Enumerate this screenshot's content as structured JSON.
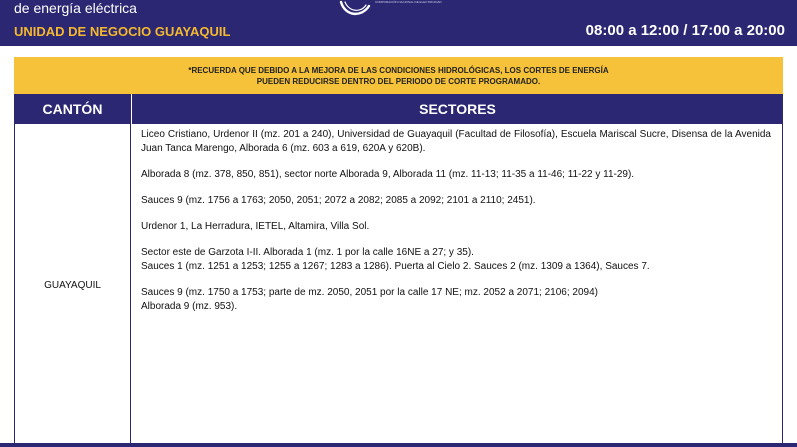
{
  "header": {
    "line1": "de energía eléctrica",
    "line2": "UNIDAD DE NEGOCIO GUAYAQUIL",
    "schedule": "08:00 a 12:00 / 17:00 a 20:00",
    "logo_tagline": "CORPORACIÓN NACIONAL DE ELECTRICIDAD"
  },
  "notice": {
    "line1": "*RECUERDA QUE DEBIDO A LA MEJORA DE LAS CONDICIONES HIDROLÓGICAS, LOS CORTES DE ENERGÍA",
    "line2": "PUEDEN REDUCIRSE DENTRO DEL PERIODO DE CORTE PROGRAMADO."
  },
  "table": {
    "col_canton": "CANTÓN",
    "col_sectores": "SECTORES",
    "canton": "GUAYAQUIL",
    "groups": [
      [
        "Liceo Cristiano, Urdenor II (mz. 201 a 240), Universidad de Guayaquil (Facultad de Filosofía), Escuela Mariscal Sucre, Disensa de la Avenida Juan Tanca Marengo, Alborada 6 (mz. 603 a 619, 620A y 620B)."
      ],
      [
        "Alborada 8 (mz. 378, 850, 851), sector norte Alborada 9, Alborada 11 (mz. 11-13; 11-35 a 11-46; 11-22 y 11-29)."
      ],
      [
        "Sauces 9 (mz. 1756 a 1763; 2050, 2051; 2072 a 2082; 2085 a 2092; 2101 a 2110; 2451)."
      ],
      [
        "Urdenor 1, La Herradura, IETEL, Altamira, Villa Sol."
      ],
      [
        "Sector este de Garzota I-II. Alborada 1 (mz. 1 por la calle 16NE a 27; y 35).",
        "Sauces 1 (mz. 1251 a 1253; 1255 a 1267; 1283 a 1286). Puerta al Cielo 2. Sauces 2 (mz. 1309 a 1364), Sauces 7."
      ],
      [
        "Sauces 9 (mz. 1750 a 1753; parte de mz. 2050, 2051 por la calle 17 NE; mz. 2052 a 2071; 2106; 2094)",
        "Alborada 9 (mz. 953)."
      ]
    ]
  },
  "colors": {
    "brand_navy": "#2b2773",
    "accent_yellow": "#f6c23a",
    "header_orange": "#f5b82e"
  }
}
